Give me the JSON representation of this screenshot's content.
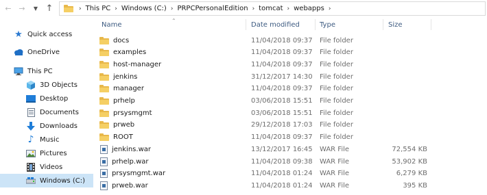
{
  "addressbar": {
    "crumbs": [
      "This PC",
      "Windows (C:)",
      "PRPCPersonalEdition",
      "tomcat",
      "webapps"
    ]
  },
  "sidebar": {
    "items": [
      {
        "label": "Quick access",
        "icon": "star-icon"
      },
      {
        "label": "OneDrive",
        "icon": "cloud-icon"
      },
      {
        "label": "This PC",
        "icon": "computer-icon"
      },
      {
        "label": "3D Objects",
        "icon": "cube-icon"
      },
      {
        "label": "Desktop",
        "icon": "desktop-icon"
      },
      {
        "label": "Documents",
        "icon": "document-icon"
      },
      {
        "label": "Downloads",
        "icon": "download-arrow-icon"
      },
      {
        "label": "Music",
        "icon": "music-note-icon"
      },
      {
        "label": "Pictures",
        "icon": "picture-icon"
      },
      {
        "label": "Videos",
        "icon": "film-icon"
      },
      {
        "label": "Windows (C:)",
        "icon": "drive-icon"
      }
    ],
    "selected": "Windows (C:)"
  },
  "columns": {
    "name": "Name",
    "date": "Date modified",
    "type": "Type",
    "size": "Size"
  },
  "files": [
    {
      "name": "docs",
      "date": "11/04/2018 09:37",
      "type": "File folder",
      "size": "",
      "kind": "folder"
    },
    {
      "name": "examples",
      "date": "11/04/2018 09:37",
      "type": "File folder",
      "size": "",
      "kind": "folder"
    },
    {
      "name": "host-manager",
      "date": "11/04/2018 09:37",
      "type": "File folder",
      "size": "",
      "kind": "folder"
    },
    {
      "name": "jenkins",
      "date": "31/12/2017 14:30",
      "type": "File folder",
      "size": "",
      "kind": "folder"
    },
    {
      "name": "manager",
      "date": "11/04/2018 09:37",
      "type": "File folder",
      "size": "",
      "kind": "folder"
    },
    {
      "name": "prhelp",
      "date": "03/06/2018 15:51",
      "type": "File folder",
      "size": "",
      "kind": "folder"
    },
    {
      "name": "prsysmgmt",
      "date": "03/06/2018 15:51",
      "type": "File folder",
      "size": "",
      "kind": "folder"
    },
    {
      "name": "prweb",
      "date": "29/12/2018 17:03",
      "type": "File folder",
      "size": "",
      "kind": "folder"
    },
    {
      "name": "ROOT",
      "date": "11/04/2018 09:37",
      "type": "File folder",
      "size": "",
      "kind": "folder"
    },
    {
      "name": "jenkins.war",
      "date": "13/12/2017 16:45",
      "type": "WAR File",
      "size": "72,554 KB",
      "kind": "war"
    },
    {
      "name": "prhelp.war",
      "date": "11/04/2018 09:38",
      "type": "WAR File",
      "size": "53,902 KB",
      "kind": "war"
    },
    {
      "name": "prsysmgmt.war",
      "date": "11/04/2018 01:24",
      "type": "WAR File",
      "size": "6,279 KB",
      "kind": "war"
    },
    {
      "name": "prweb.war",
      "date": "11/04/2018 01:24",
      "type": "WAR File",
      "size": "395 KB",
      "kind": "war"
    }
  ]
}
